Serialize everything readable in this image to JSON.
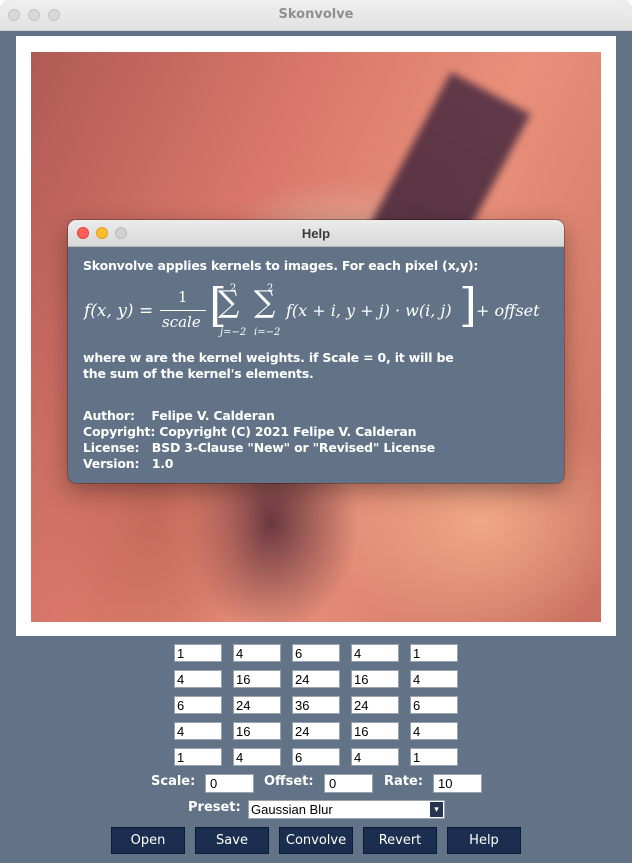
{
  "window": {
    "title": "Skonvolve"
  },
  "help": {
    "title": "Help",
    "intro": "Skonvolve applies kernels to images. For each pixel (x,y):",
    "formula": {
      "lhs": "f(x, y) =",
      "frac_num": "1",
      "frac_den": "scale",
      "sum_top": "2",
      "sum_bottom_j": "j=−2",
      "sum_bottom_i": "i=−2",
      "sigma": "∑",
      "body": "f(x + i, y + j) · w(i, j)",
      "tail": "+ offset"
    },
    "desc_line1": "where w are the kernel weights. if Scale = 0, it will be",
    "desc_line2": "the sum of the kernel's elements.",
    "author": "Author:    Felipe V. Calderan",
    "copyright": "Copyright: Copyright (C) 2021 Felipe V. Calderan",
    "license": "License:   BSD 3-Clause \"New\" or \"Revised\" License",
    "version": "Version:   1.0"
  },
  "kernel": [
    [
      "1",
      "4",
      "6",
      "4",
      "1"
    ],
    [
      "4",
      "16",
      "24",
      "16",
      "4"
    ],
    [
      "6",
      "24",
      "36",
      "24",
      "6"
    ],
    [
      "4",
      "16",
      "24",
      "16",
      "4"
    ],
    [
      "1",
      "4",
      "6",
      "4",
      "1"
    ]
  ],
  "params": {
    "scale_label": "Scale:",
    "scale_value": "0",
    "offset_label": "Offset:",
    "offset_value": "0",
    "rate_label": "Rate:",
    "rate_value": "10"
  },
  "preset": {
    "label": "Preset:",
    "value": "Gaussian Blur",
    "arrow": "▾"
  },
  "buttons": {
    "open": "Open",
    "save": "Save",
    "convolve": "Convolve",
    "revert": "Revert",
    "help": "Help"
  },
  "colors": {
    "bg": "#627387",
    "button": "#1c2e4f",
    "close": "#fe5f57",
    "minimize": "#febc2e",
    "zoom": "#d0d0d0"
  }
}
